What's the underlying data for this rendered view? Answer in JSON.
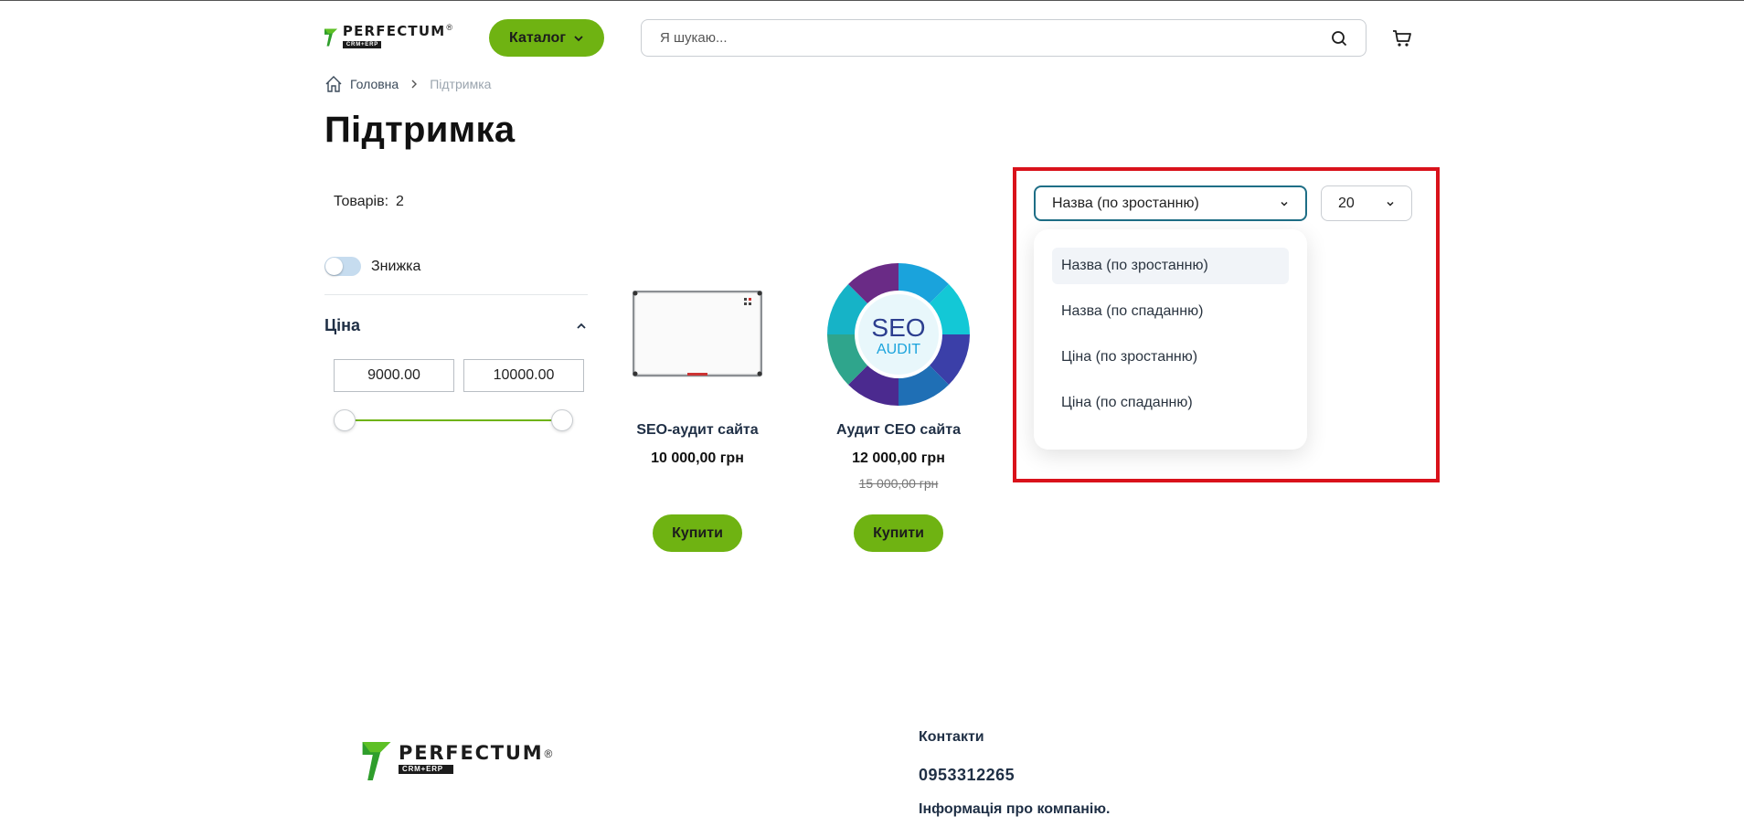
{
  "header": {
    "logo_text": "PERFECTUM",
    "logo_subtext": "CRM+ERP",
    "logo_reg": "®",
    "catalog_label": "Каталог",
    "search_placeholder": "Я шукаю..."
  },
  "breadcrumb": {
    "home": "Головна",
    "current": "Підтримка"
  },
  "page_title": "Підтримка",
  "sidebar": {
    "count_label": "Товарів:",
    "count_value": "2",
    "discount_label": "Знижка",
    "discount_on": false,
    "price_title": "Ціна",
    "price_min": "9000.00",
    "price_max": "10000.00"
  },
  "products": [
    {
      "name": "SEO-аудит сайта",
      "price": "10 000,00 грн",
      "buy": "Купити"
    },
    {
      "name": "Аудит СЕО сайта",
      "price": "12 000,00 грн",
      "old_price": "15 000,00 грн",
      "buy": "Купити",
      "img_text_1": "SEO",
      "img_text_2": "AUDIT"
    }
  ],
  "sort": {
    "selected": "Назва (по зростанню)",
    "per_page": "20",
    "options": [
      "Назва (по зростанню)",
      "Назва (по спаданню)",
      "Ціна (по зростанню)",
      "Ціна (по спаданню)"
    ]
  },
  "footer": {
    "contacts_title": "Контакти",
    "phone": "0953312265",
    "info": "Інформація про компанію."
  },
  "colors": {
    "accent": "#6fb312",
    "highlight": "#d9121b",
    "select_border": "#1e6e86"
  }
}
